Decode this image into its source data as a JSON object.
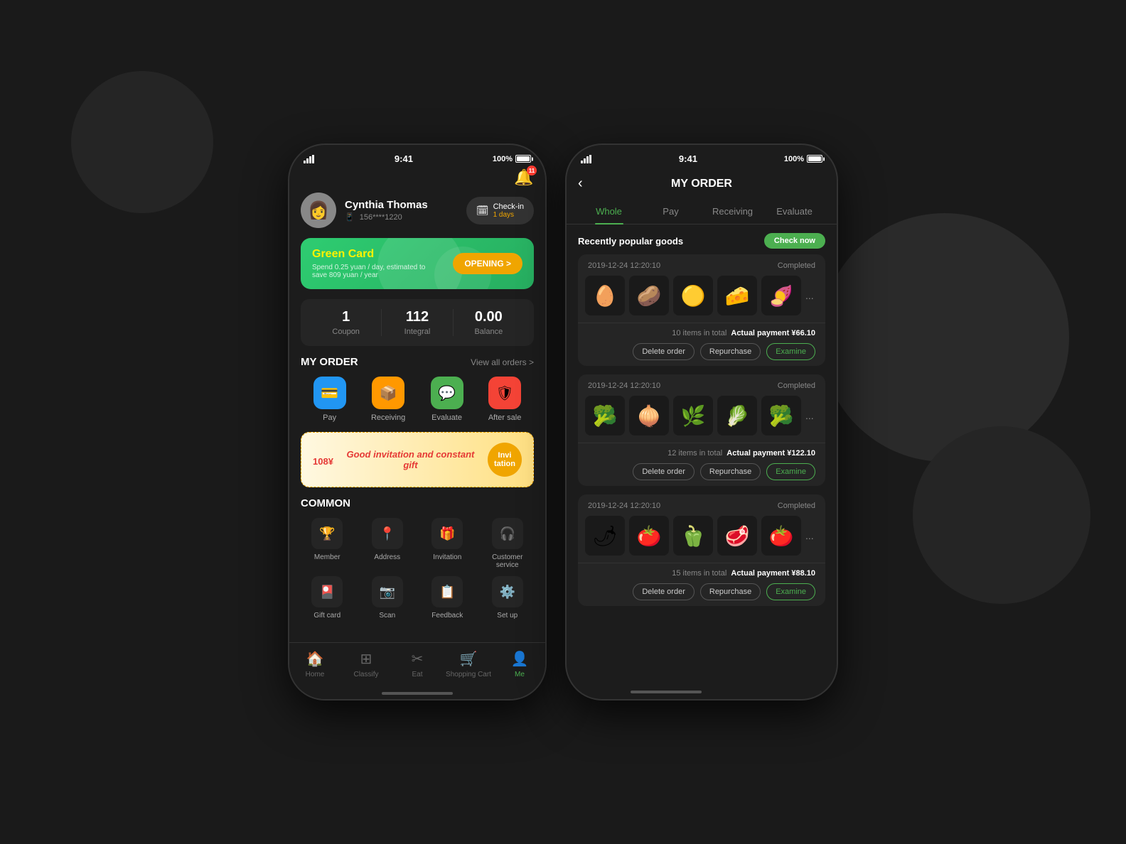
{
  "background": {
    "color": "#1a1a1a"
  },
  "phone_left": {
    "status_bar": {
      "time": "9:41",
      "battery": "100%"
    },
    "notification": {
      "badge": "11"
    },
    "profile": {
      "name": "Cynthia Thomas",
      "phone": "156****1220",
      "avatar_emoji": "👩",
      "checkin_label": "Check-in",
      "checkin_days": "1 days"
    },
    "green_card": {
      "title": "Green Card",
      "desc": "Spend 0.25 yuan / day, estimated to save 809 yuan / year",
      "button": "OPENING >"
    },
    "stats": [
      {
        "value": "1",
        "label": "Coupon"
      },
      {
        "value": "112",
        "label": "Integral"
      },
      {
        "value": "0.00",
        "label": "Balance"
      }
    ],
    "my_order": {
      "title": "MY ORDER",
      "view_all": "View all orders >",
      "items": [
        {
          "label": "Pay",
          "icon": "💳",
          "color": "icon-blue"
        },
        {
          "label": "Receiving",
          "icon": "📦",
          "color": "icon-orange"
        },
        {
          "label": "Evaluate",
          "icon": "💬",
          "color": "icon-green"
        },
        {
          "label": "After sale",
          "icon": "🛡",
          "color": "icon-red"
        }
      ]
    },
    "invite_banner": {
      "amount": "108",
      "currency": "¥",
      "text": "Good invitation and constant gift",
      "badge": "Invi tation"
    },
    "common": {
      "title": "COMMON",
      "items": [
        {
          "label": "Member",
          "icon": "🏆"
        },
        {
          "label": "Address",
          "icon": "📍"
        },
        {
          "label": "Invitation",
          "icon": "🎁"
        },
        {
          "label": "Customer service",
          "icon": "🎧"
        },
        {
          "label": "Gift card",
          "icon": "🎴"
        },
        {
          "label": "Scan",
          "icon": "📷"
        },
        {
          "label": "Feedback",
          "icon": "📋"
        },
        {
          "label": "Set up",
          "icon": "⚙️"
        }
      ]
    },
    "bottom_nav": {
      "items": [
        {
          "label": "Home",
          "icon": "🏠",
          "active": false
        },
        {
          "label": "Classify",
          "icon": "⊞",
          "active": false
        },
        {
          "label": "Eat",
          "icon": "✂",
          "active": false
        },
        {
          "label": "Shopping Cart",
          "icon": "🛒",
          "active": false
        },
        {
          "label": "Me",
          "icon": "👤",
          "active": true
        }
      ]
    }
  },
  "phone_right": {
    "status_bar": {
      "time": "9:41",
      "battery": "100%"
    },
    "header": {
      "back_icon": "‹",
      "title": "MY ORDER"
    },
    "tabs": [
      {
        "label": "Whole",
        "active": true
      },
      {
        "label": "Pay",
        "active": false
      },
      {
        "label": "Receiving",
        "active": false
      },
      {
        "label": "Evaluate",
        "active": false
      }
    ],
    "popular_goods": {
      "label": "Recently popular goods",
      "button": "Check now"
    },
    "orders": [
      {
        "date": "2019-12-24  12:20:10",
        "status": "Completed",
        "items_emoji": [
          "🥚",
          "🥔",
          "🟡",
          "🧀",
          "🍠"
        ],
        "summary": "10 items in total",
        "payment": "Actual payment ¥66.10",
        "actions": [
          "Delete order",
          "Repurchase",
          "Examine"
        ]
      },
      {
        "date": "2019-12-24  12:20:10",
        "status": "Completed",
        "items_emoji": [
          "🥦",
          "🧅",
          "🌿",
          "🥬",
          "🥦"
        ],
        "summary": "12 items in total",
        "payment": "Actual payment ¥122.10",
        "actions": [
          "Delete order",
          "Repurchase",
          "Examine"
        ]
      },
      {
        "date": "2019-12-24  12:20:10",
        "status": "Completed",
        "items_emoji": [
          "🌶",
          "🍅",
          "🫑",
          "🥩",
          "🍅"
        ],
        "summary": "15 items in total",
        "payment": "Actual payment ¥88.10",
        "actions": [
          "Delete order",
          "Repurchase",
          "Examine"
        ]
      }
    ]
  }
}
